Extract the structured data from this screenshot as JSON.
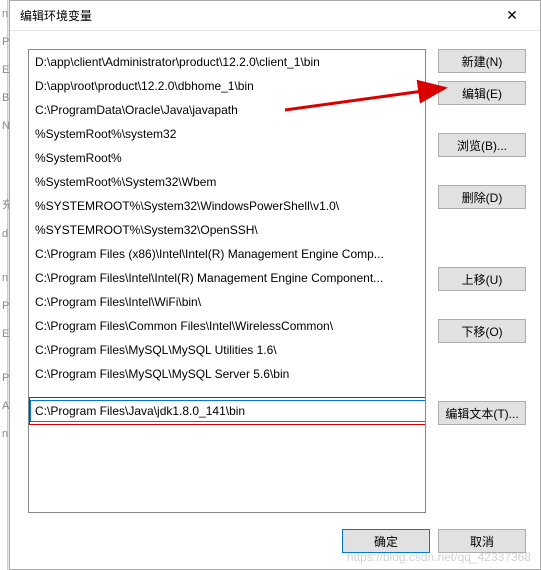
{
  "dialog": {
    "title": "编辑环境变量",
    "close_label": "✕"
  },
  "paths": [
    "D:\\app\\client\\Administrator\\product\\12.2.0\\client_1\\bin",
    "D:\\app\\root\\product\\12.2.0\\dbhome_1\\bin",
    "C:\\ProgramData\\Oracle\\Java\\javapath",
    "%SystemRoot%\\system32",
    "%SystemRoot%",
    "%SystemRoot%\\System32\\Wbem",
    "%SYSTEMROOT%\\System32\\WindowsPowerShell\\v1.0\\",
    "%SYSTEMROOT%\\System32\\OpenSSH\\",
    "C:\\Program Files (x86)\\Intel\\Intel(R) Management Engine Comp...",
    "C:\\Program Files\\Intel\\Intel(R) Management Engine Component...",
    "C:\\Program Files\\Intel\\WiFi\\bin\\",
    "C:\\Program Files\\Common Files\\Intel\\WirelessCommon\\",
    "C:\\Program Files\\MySQL\\MySQL Utilities 1.6\\",
    "C:\\Program Files\\MySQL\\MySQL Server 5.6\\bin"
  ],
  "editing_value": "C:\\Program Files\\Java\\jdk1.8.0_141\\bin",
  "buttons": {
    "new": "新建(N)",
    "edit": "编辑(E)",
    "browse": "浏览(B)...",
    "delete": "删除(D)",
    "up": "上移(U)",
    "down": "下移(O)",
    "edit_text": "编辑文本(T)...",
    "ok": "确定",
    "cancel": "取消"
  },
  "watermark": "https://blog.csdn.net/qq_42337368"
}
